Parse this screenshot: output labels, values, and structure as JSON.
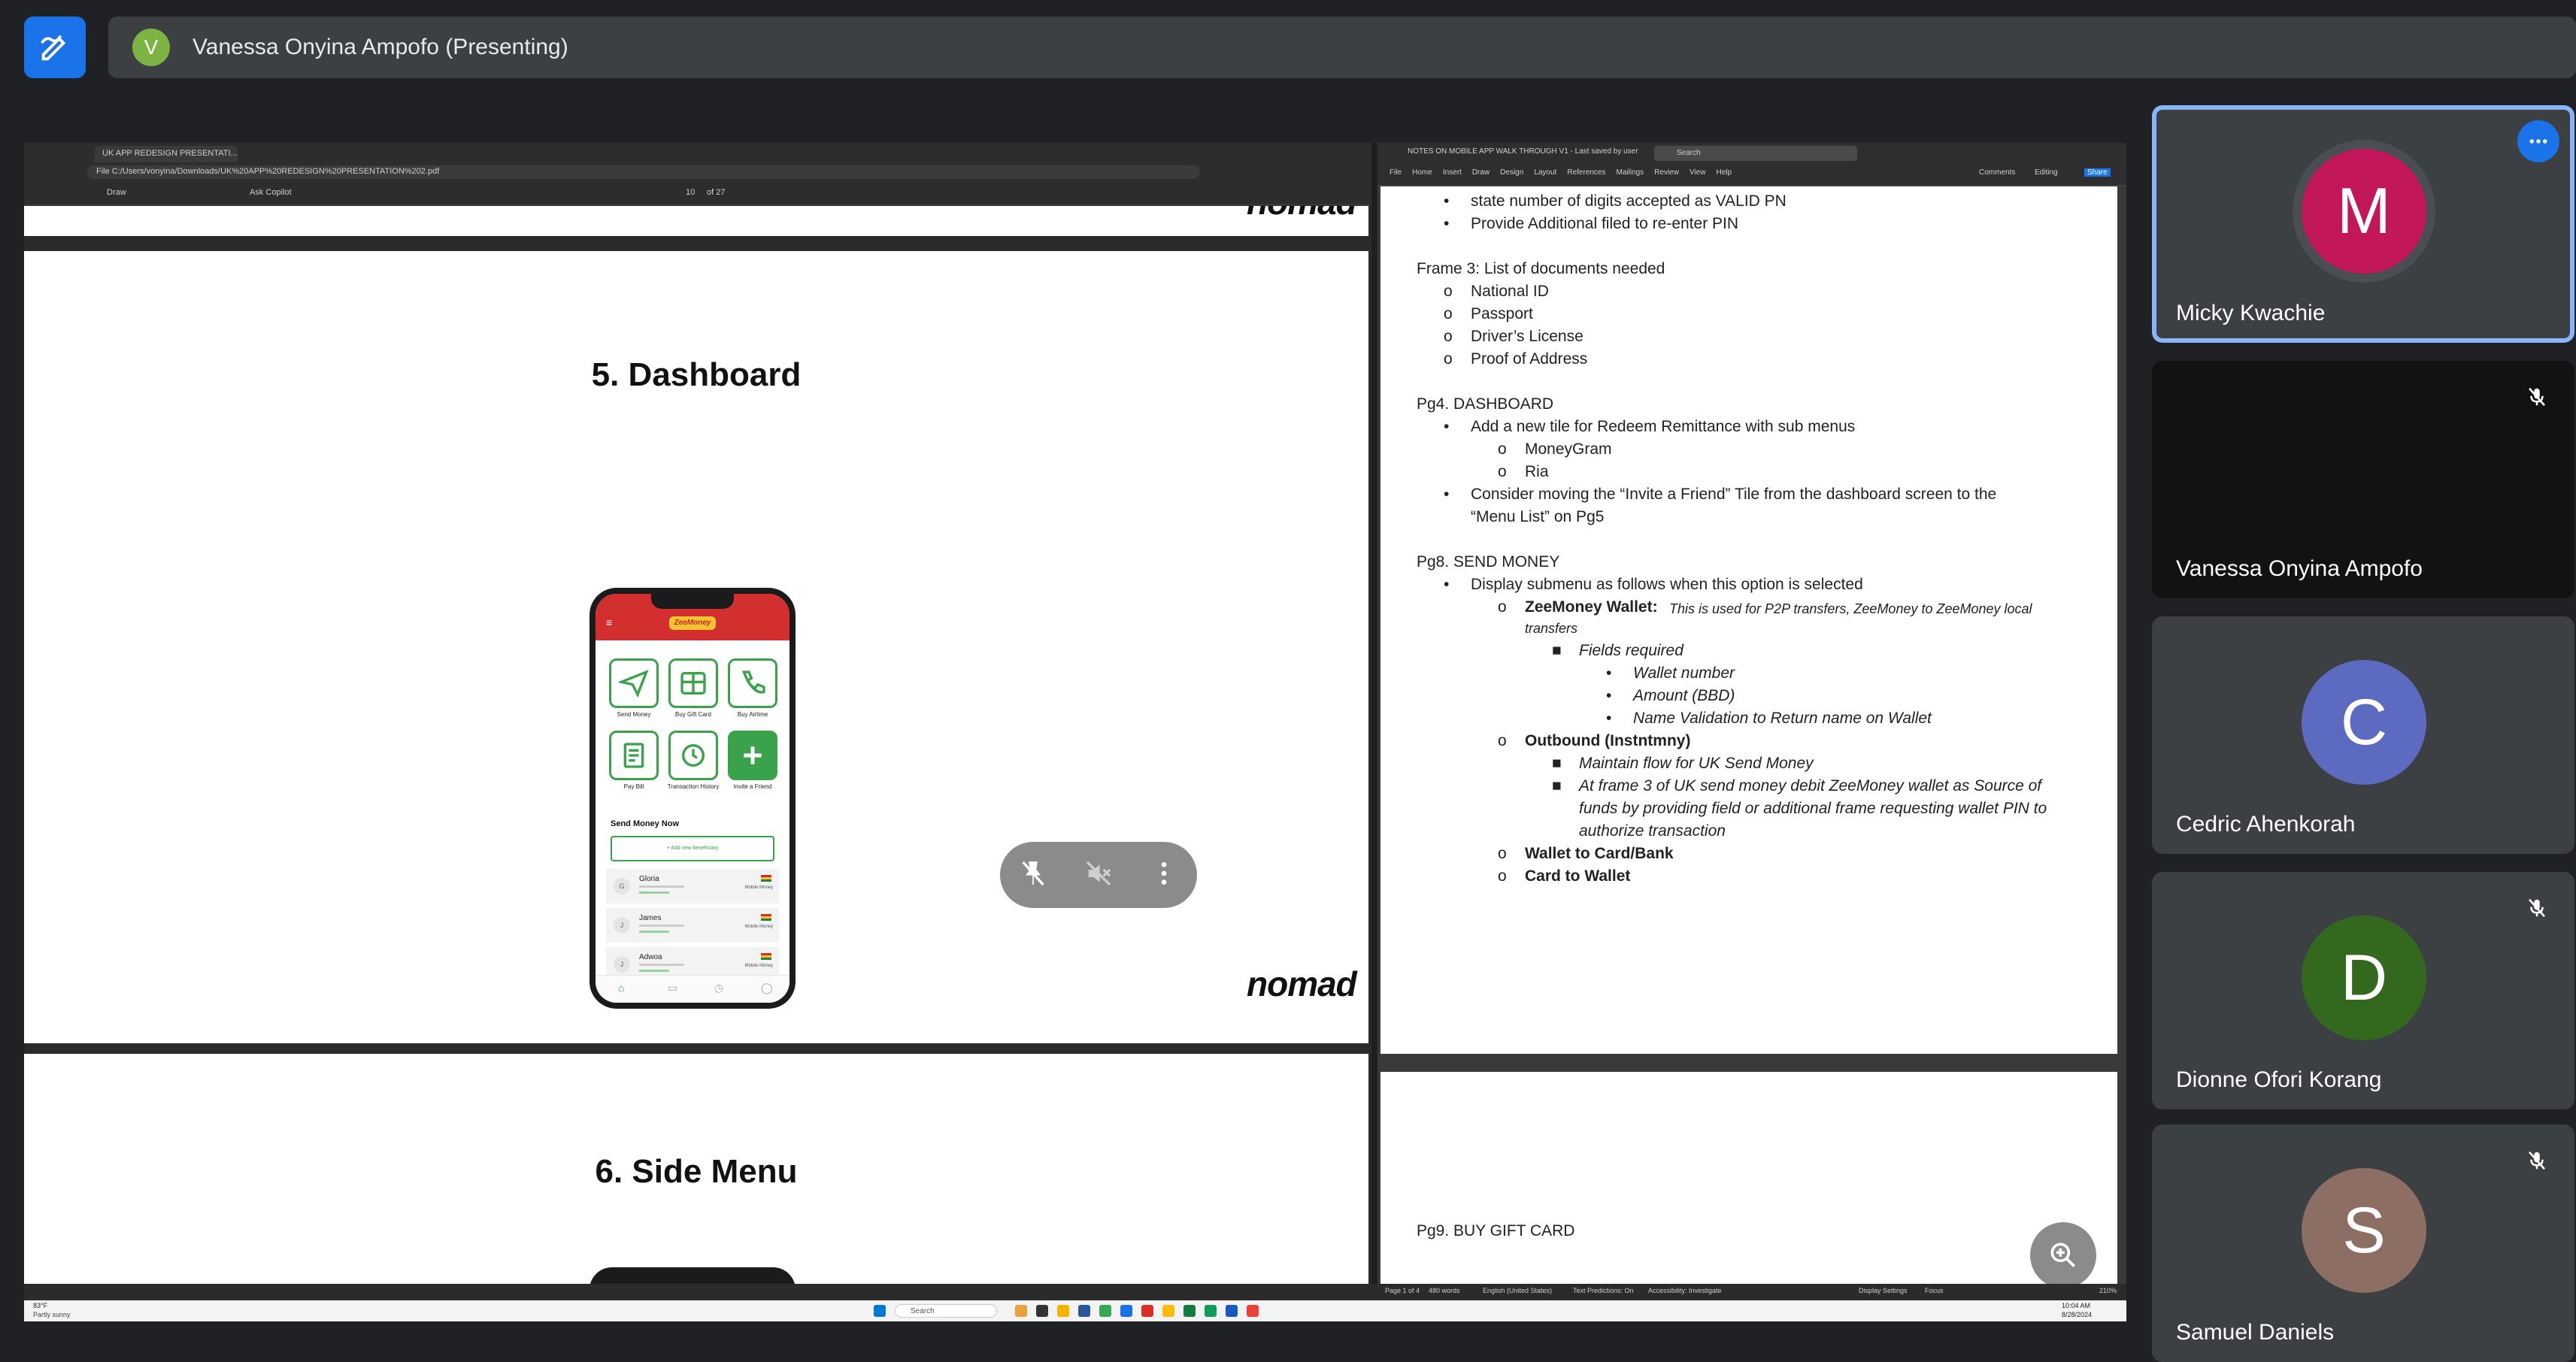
{
  "presenter": {
    "initial": "V",
    "label": "Vanessa Onyina Ampofo (Presenting)"
  },
  "pdf": {
    "tab_title": "UK APP REDESIGN PRESENTATI...",
    "address": "File  C:/Users/vonyina/Downloads/UK%20APP%20REDESIGN%20PRESENTATION%202.pdf",
    "toolbar_draw": "Draw",
    "toolbar_ask": "Ask Copilot",
    "page_current": "10",
    "page_total": "of 27",
    "slide5_title": "5. Dashboard",
    "slide6_title": "6. Side Menu",
    "brand": "nomad"
  },
  "phone": {
    "logo": "ZeeMoney",
    "tiles": [
      "Send Money",
      "Buy Gift Card",
      "Buy Airtime",
      "Pay Bill",
      "Transaction History",
      "Invite a Friend"
    ],
    "send_money_now": "Send Money Now",
    "add_beneficiary": "+ Add new beneficiary",
    "beneficiaries": [
      {
        "initial": "G",
        "name": "Gloria",
        "provider": "Mobile Money"
      },
      {
        "initial": "J",
        "name": "James",
        "provider": "Mobile Money"
      },
      {
        "initial": "J",
        "name": "Adwoa",
        "provider": "Mobile Money"
      }
    ]
  },
  "word": {
    "title": "NOTES ON MOBILE APP WALK THROUGH V1 - Last saved by user",
    "search_placeholder": "Search",
    "ribbon": [
      "File",
      "Home",
      "Insert",
      "Draw",
      "Design",
      "Layout",
      "References",
      "Mailings",
      "Review",
      "View",
      "Help"
    ],
    "comments": "Comments",
    "editing": "Editing",
    "share": "Share",
    "lines": {
      "l1": "state number of digits accepted as VALID PN",
      "l2": "Provide Additional filed to re-enter PIN",
      "frame3": "Frame 3: List of documents needed",
      "doc1": "National ID",
      "doc2": "Passport",
      "doc3": "Driver’s License",
      "doc4": "Proof of Address",
      "pg4": "Pg4. DASHBOARD",
      "pg4_b1": "Add a new tile for Redeem Remittance with sub menus",
      "pg4_s1": "MoneyGram",
      "pg4_s2": "Ria",
      "pg4_b2a": "Consider moving the “Invite a Friend” Tile from the dashboard screen to the",
      "pg4_b2b": "“Menu List” on Pg5",
      "pg8": "Pg8. SEND MONEY",
      "pg8_b1": "Display submenu as follows when this option is selected",
      "zw_bold": "ZeeMoney Wallet:",
      "zw_desc1": "This is used for P2P transfers, ZeeMoney to ZeeMoney local",
      "zw_desc2": "transfers",
      "fields": "Fields required",
      "f1": "Wallet number",
      "f2": "Amount (BBD)",
      "f3": "Name Validation to Return name on Wallet",
      "outbound": "Outbound (Instntmny)",
      "ob1": "Maintain flow for UK Send Money",
      "ob2a": "At frame 3 of UK send money debit ZeeMoney wallet as Source of",
      "ob2b": "funds by providing field or additional frame requesting wallet PIN to",
      "ob2c": "authorize transaction",
      "w2c": "Wallet to Card/Bank",
      "c2w": "Card to Wallet",
      "pg9": "Pg9. BUY GIFT CARD"
    },
    "status_page": "Page 1 of 4",
    "status_words": "480 words",
    "status_lang": "English (United States)",
    "status_predictions": "Text Predictions: On",
    "status_access": "Accessibility: Investigate",
    "status_display": "Display Settings",
    "status_focus": "Focus",
    "status_zoom": "210%"
  },
  "taskbar": {
    "weather_temp": "83°F",
    "weather_desc": "Partly sunny",
    "search": "Search",
    "time": "10:04 AM",
    "date": "8/28/2024"
  },
  "participants": [
    {
      "name": "Micky Kwachie",
      "initial": "M",
      "color": "#c2185b",
      "muted": false,
      "active": true
    },
    {
      "name": "Vanessa Onyina Ampofo",
      "initial": "",
      "color": "",
      "muted": true,
      "active": false
    },
    {
      "name": "Cedric Ahenkorah",
      "initial": "C",
      "color": "#5c6bc0",
      "muted": false,
      "active": false
    },
    {
      "name": "Dionne Ofori Korang",
      "initial": "D",
      "color": "#33691e",
      "muted": true,
      "active": false
    },
    {
      "name": "Samuel Daniels",
      "initial": "S",
      "color": "#8d6e63",
      "muted": true,
      "active": false
    }
  ]
}
